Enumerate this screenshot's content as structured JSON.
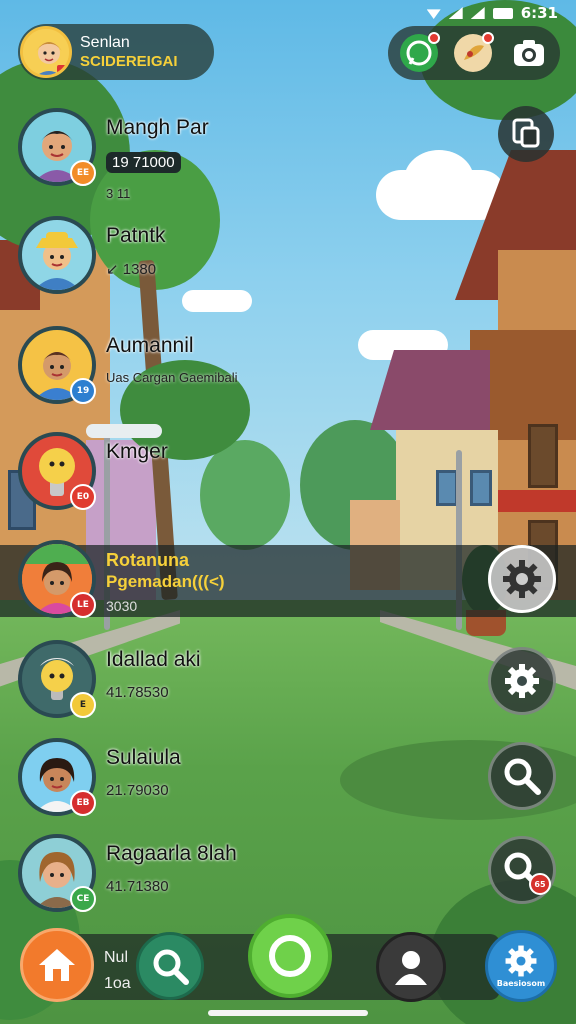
{
  "status_bar": {
    "time": "6:31"
  },
  "profile": {
    "name": "Senlan",
    "title": "SCIDEREIGAI"
  },
  "friends": [
    {
      "name": "Mangh Par",
      "score": "19 71000",
      "sub": "3 11",
      "badge": "EE",
      "badge_color": "#f28c28",
      "avatar_bg": "#7ecfe0"
    },
    {
      "name": "Patntk",
      "score": "1380",
      "sub": "",
      "badge": "",
      "badge_color": "#ffffff",
      "avatar_bg": "#8fd6e6"
    },
    {
      "name": "Aumannil",
      "score": "Uas Cargan Gaemibali",
      "sub": "",
      "badge": "19",
      "badge_color": "#2d7fd0",
      "avatar_bg": "#f5c245"
    },
    {
      "name": "Kmger",
      "score": "",
      "sub": "",
      "badge": "E0",
      "badge_color": "#e03b2f",
      "avatar_bg": "#e04a3a"
    },
    {
      "name": "Rotanuna",
      "score": "Pgemadan(((<)",
      "score2": "3030",
      "badge": "LE",
      "badge_color": "#d62e2e",
      "avatar_bg": "#f07e3a"
    },
    {
      "name": "Idallad aki",
      "score": "41.78530",
      "sub": "",
      "badge": "E",
      "badge_color": "#f2c93a",
      "avatar_bg": "#3f6a6a"
    },
    {
      "name": "Sulaiula",
      "score": "21.79030",
      "sub": "",
      "badge": "EB",
      "badge_color": "#d62e2e",
      "avatar_bg": "#7fcff0"
    },
    {
      "name": "Ragaarla 8lah",
      "score": "41.71380",
      "sub": "",
      "badge": "CE",
      "badge_color": "#3aa84a",
      "avatar_bg": "#8ecfd6"
    }
  ],
  "side_buttons": [
    {
      "icon": "gear-icon"
    },
    {
      "icon": "gear-icon"
    },
    {
      "icon": "search-icon"
    },
    {
      "icon": "search-icon",
      "badge": "65"
    }
  ],
  "bottom_nav": {
    "strip_line1": "Nul",
    "strip_line2": "1oa",
    "settings_label": "Baesiosom"
  },
  "colors": {
    "accent_yellow": "#f6d03a",
    "home": "#f27a2c",
    "search": "#2b8a63",
    "center": "#6fd14a",
    "settings": "#2f8fd4"
  }
}
